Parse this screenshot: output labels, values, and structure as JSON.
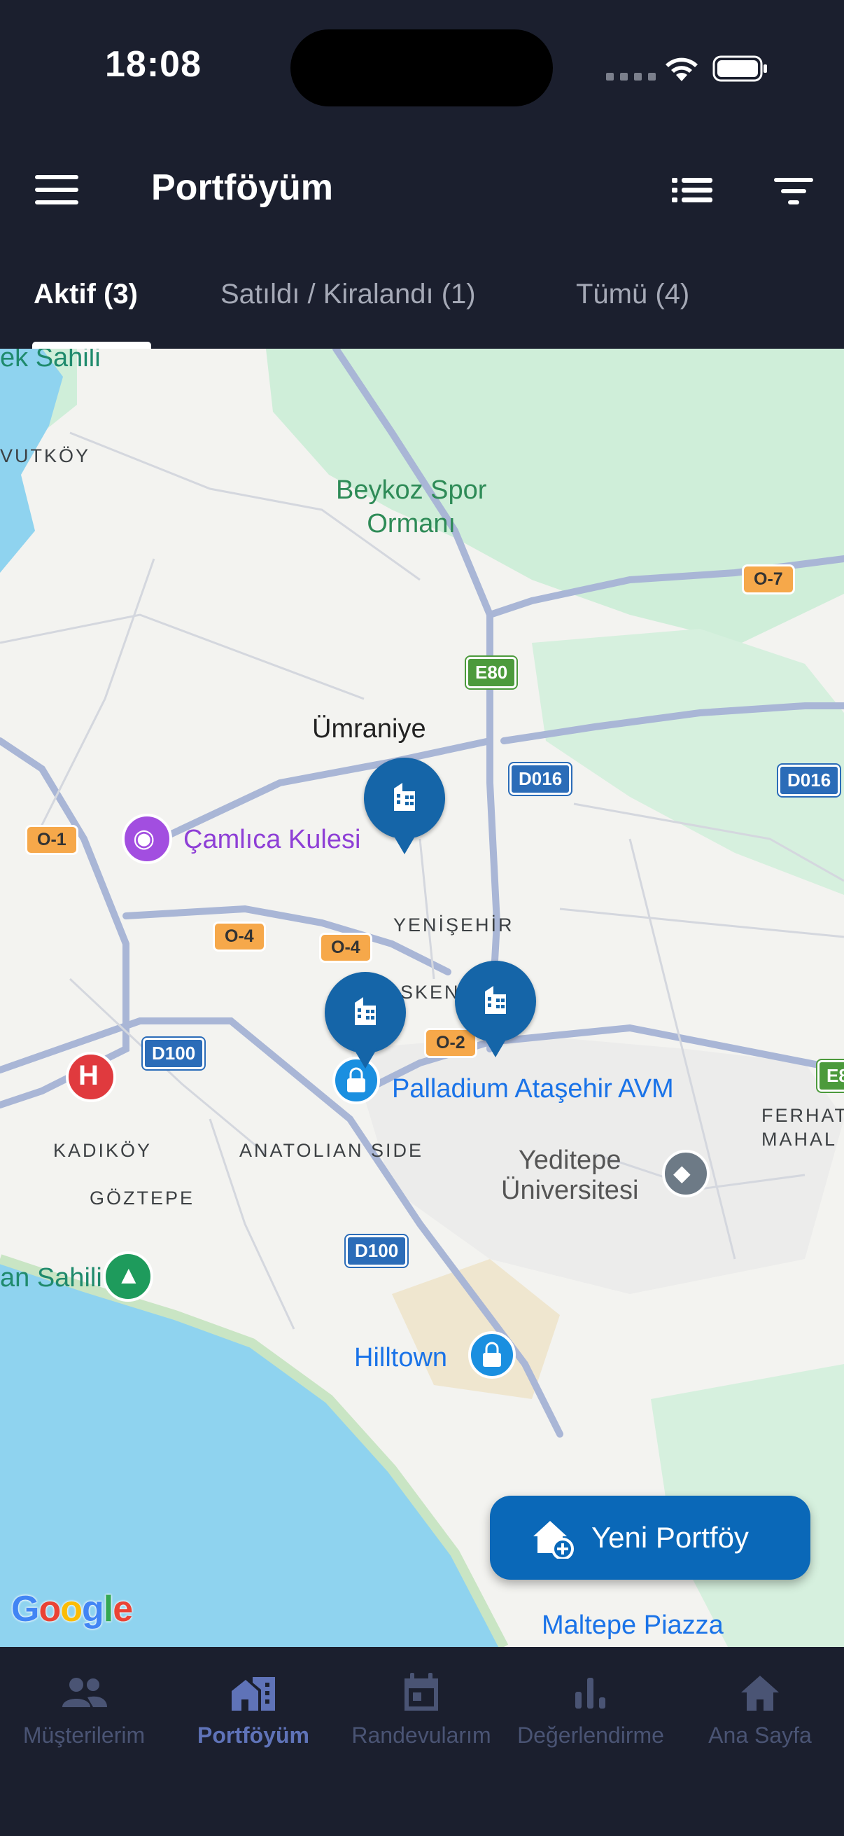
{
  "status_bar": {
    "time": "18:08"
  },
  "app_bar": {
    "title": "Portföyüm"
  },
  "tabs": [
    {
      "label": "Aktif (3)"
    },
    {
      "label": "Satıldı / Kiralandı (1)"
    },
    {
      "label": "Tümü (4)"
    }
  ],
  "map": {
    "labels": {
      "beykoz": "Beykoz Spor\nOrmanı",
      "umraniye": "Ümraniye",
      "camlica": "Çamlıca Kulesi",
      "yenisehir": "YENİŞEHİR",
      "kent": "SKENT",
      "palladium": "Palladium Ataşehir AVM",
      "kadikoy": "KADIKÖY",
      "goztepe": "GÖZTEPE",
      "anatolian": "ANATOLIAN SIDE",
      "yeditepe": "Yeditepe\nÜniversitesi",
      "ferhat": "FERHAT\nMAHAL",
      "sahili_top": "ek Sahili",
      "vutkoy": "VUTKÖY",
      "sahili_bottom": "an Sahili",
      "hilltown": "Hilltown",
      "maltepe": "Maltepe Piazza"
    },
    "road_shields": {
      "o7": "O-7",
      "e80": "E80",
      "d016a": "D016",
      "d016b": "D016",
      "o1": "O-1",
      "o4a": "O-4",
      "o4b": "O-4",
      "d100a": "D100",
      "o2": "O-2",
      "d100b": "D100",
      "e8": "E8"
    },
    "attribution": "Google"
  },
  "fab": {
    "label": "Yeni Portföy"
  },
  "bottom_nav": [
    {
      "label": "Müşterilerim",
      "active": false
    },
    {
      "label": "Portföyüm",
      "active": true
    },
    {
      "label": "Randevularım",
      "active": false
    },
    {
      "label": "Değerlendirme",
      "active": false
    },
    {
      "label": "Ana Sayfa",
      "active": false
    }
  ],
  "colors": {
    "bar": "#1b1f2e",
    "pin": "#1565a8",
    "fab": "#0a68b8",
    "nav_active": "#5f73b8",
    "nav_inactive": "#4a5474"
  }
}
